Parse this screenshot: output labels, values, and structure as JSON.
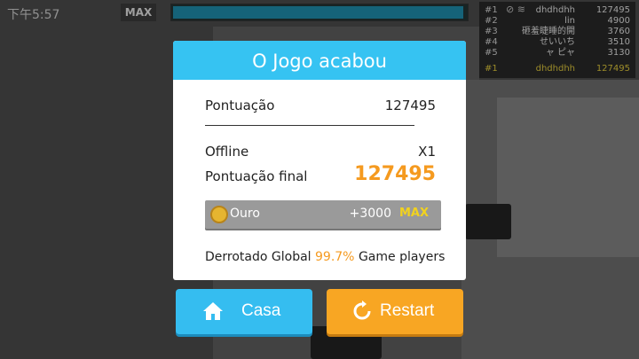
{
  "status": {
    "time": "下午5:57"
  },
  "hud": {
    "max_label": "MAX",
    "progress_fraction": 0.99
  },
  "leaderboard": {
    "rows": [
      {
        "rank": "#1",
        "name": "dhdhdhh",
        "score": "127495"
      },
      {
        "rank": "#2",
        "name": "lin",
        "score": "4900"
      },
      {
        "rank": "#3",
        "name": "砸羞睫睡的開",
        "score": "3760"
      },
      {
        "rank": "#4",
        "name": "せいいち",
        "score": "3510"
      },
      {
        "rank": "#5",
        "name": "ャ ピャ",
        "score": "3130"
      }
    ],
    "you": {
      "rank": "#1",
      "name": "dhdhdhh",
      "score": "127495"
    }
  },
  "dialog": {
    "title": "O Jogo acabou",
    "score_label": "Pontuação",
    "score_value": "127495",
    "offline_label": "Offline",
    "offline_value": "X1",
    "final_label": "Pontuação final",
    "final_value": "127495",
    "gold_label": "Ouro",
    "gold_amount": "+3000",
    "gold_max": "MAX",
    "defeat_prefix": "Derrotado Global",
    "defeat_pct": "99.7%",
    "defeat_suffix": "Game players"
  },
  "buttons": {
    "home": "Casa",
    "restart": "Restart"
  },
  "colors": {
    "header": "#36c3f2",
    "accent_orange": "#f59a1f",
    "home_button": "#35bdf0",
    "restart_button": "#f8a623"
  }
}
